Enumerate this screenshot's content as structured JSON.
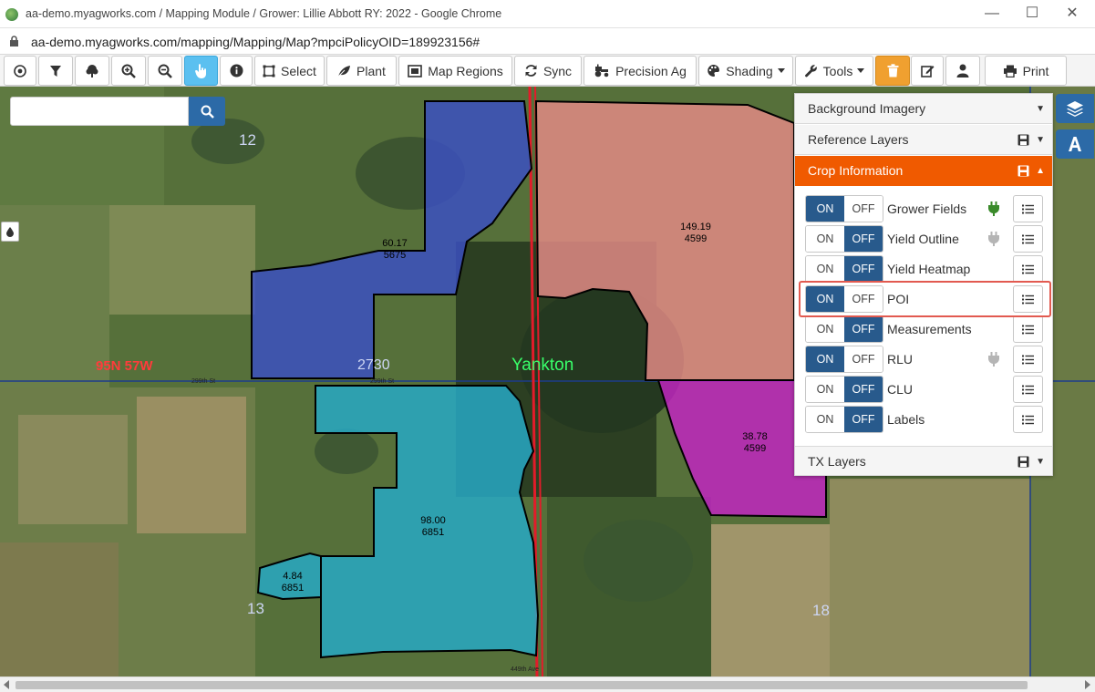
{
  "window": {
    "title": "aa-demo.myagworks.com / Mapping Module / Grower: Lillie Abbott RY: 2022 - Google Chrome",
    "url": "aa-demo.myagworks.com/mapping/Mapping/Map?mpciPolicyOID=189923156#"
  },
  "toolbar": {
    "select": "Select",
    "plant": "Plant",
    "map_regions": "Map Regions",
    "sync": "Sync",
    "precision_ag": "Precision Ag",
    "shading": "Shading",
    "tools": "Tools",
    "print": "Print"
  },
  "search": {
    "placeholder": ""
  },
  "map": {
    "town": "Yankton",
    "township": "95N 57W",
    "sections": [
      "12",
      "13",
      "18",
      "27",
      "30"
    ],
    "roads": [
      "299th St",
      "299th St",
      "449th Ave"
    ],
    "fields": [
      {
        "acres": "60.17",
        "id": "5675",
        "color": "#3a4fc6"
      },
      {
        "acres": "149.19",
        "id": "4599",
        "color": "#e08a85"
      },
      {
        "acres": "38.78",
        "id": "4599",
        "color": "#c026c0"
      },
      {
        "acres": "98.00",
        "id": "6851",
        "color": "#27a8c4"
      },
      {
        "acres": "4.84",
        "id": "6851",
        "color": "#27a8c4"
      }
    ]
  },
  "panel": {
    "background_imagery": "Background Imagery",
    "reference_layers": "Reference Layers",
    "crop_information": "Crop Information",
    "tx_layers": "TX Layers",
    "on": "ON",
    "off": "OFF",
    "layers": [
      {
        "name": "Grower Fields",
        "state": "on",
        "plug": "green"
      },
      {
        "name": "Yield Outline",
        "state": "off",
        "plug": "gray"
      },
      {
        "name": "Yield Heatmap",
        "state": "off",
        "plug": ""
      },
      {
        "name": "POI",
        "state": "on",
        "plug": ""
      },
      {
        "name": "Measurements",
        "state": "off",
        "plug": ""
      },
      {
        "name": "RLU",
        "state": "on",
        "plug": "gray"
      },
      {
        "name": "CLU",
        "state": "off",
        "plug": ""
      },
      {
        "name": "Labels",
        "state": "off",
        "plug": ""
      }
    ]
  },
  "colors": {
    "accent": "#f05a00",
    "primary": "#285a8c",
    "highlight": "#e25a50"
  }
}
